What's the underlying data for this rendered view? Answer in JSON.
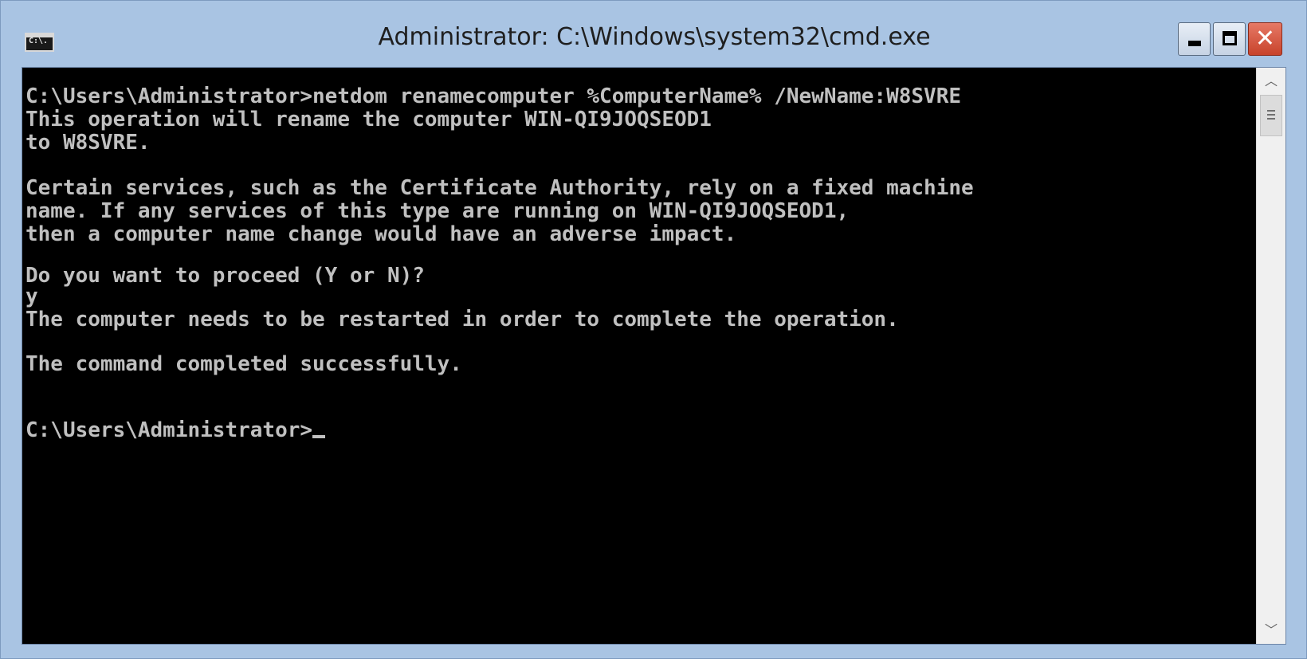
{
  "window": {
    "title": "Administrator: C:\\Windows\\system32\\cmd.exe",
    "icon": "cmd-console-icon",
    "icon_text": "C:\\."
  },
  "controls": {
    "minimize_icon": "minimize-icon",
    "maximize_icon": "maximize-icon",
    "close_icon": "close-icon",
    "close_glyph": "✕"
  },
  "console": {
    "text_color": "#c0c0c0",
    "background_color": "#000000",
    "lines": [
      "C:\\Users\\Administrator>netdom renamecomputer %ComputerName% /NewName:W8SVRE",
      "This operation will rename the computer WIN-QI9JOQSEOD1",
      "to W8SVRE.",
      "",
      "Certain services, such as the Certificate Authority, rely on a fixed machine",
      "name. If any services of this type are running on WIN-QI9JOQSEOD1,",
      "then a computer name change would have an adverse impact.",
      "",
      "Do you want to proceed (Y or N)?",
      "y",
      "The computer needs to be restarted in order to complete the operation.",
      "",
      "The command completed successfully.",
      "",
      "",
      "C:\\Users\\Administrator>"
    ]
  },
  "scrollbar": {
    "up_arrow": "︿",
    "down_arrow": "﹀"
  }
}
